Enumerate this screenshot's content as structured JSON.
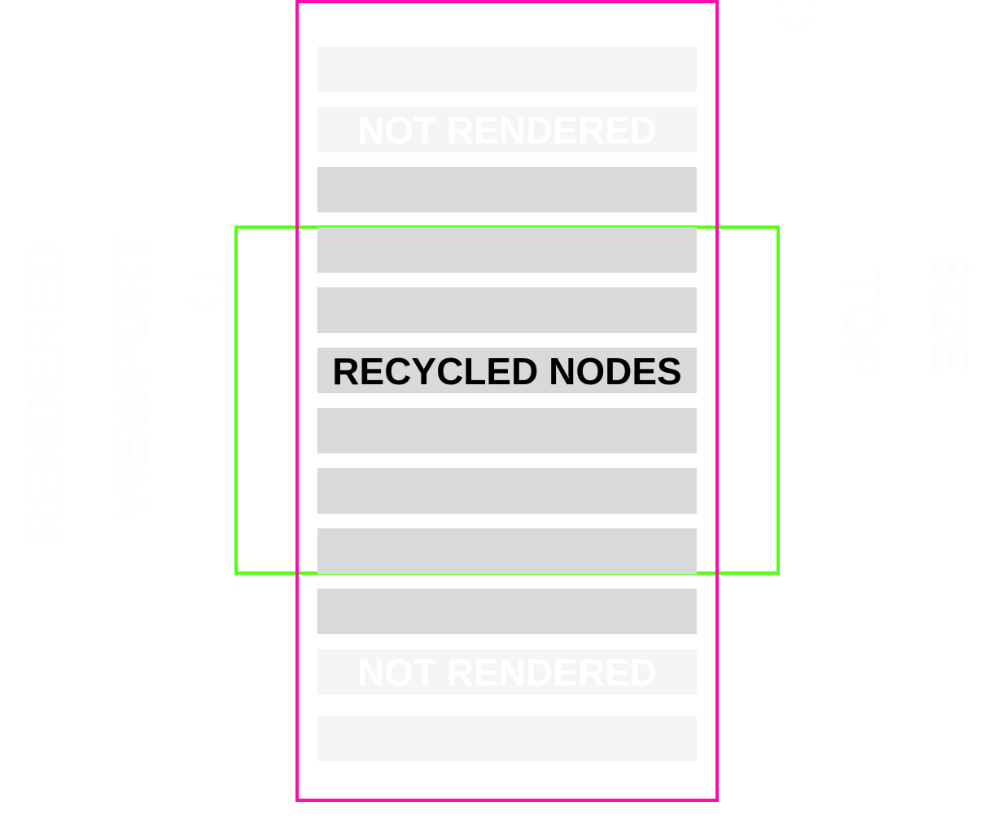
{
  "colors": {
    "list_frame": "#ff0aab",
    "viewport_frame": "#55ff11",
    "rendered_row": "#d9d9d9",
    "not_rendered_row": "#f5f5f5",
    "rendered_label": "#000000",
    "not_rendered_label": "#ffffff"
  },
  "ghost_labels": {
    "left": [
      "RENDERED",
      "VIEWPORT",
      "( )"
    ],
    "right": [
      "TOP",
      "SIZE",
      "( )"
    ]
  },
  "list": {
    "rows": [
      {
        "state": "not-rendered",
        "label": ""
      },
      {
        "state": "not-rendered",
        "label": "NOT RENDERED"
      },
      {
        "state": "rendered",
        "label": ""
      },
      {
        "state": "rendered",
        "label": ""
      },
      {
        "state": "rendered",
        "label": ""
      },
      {
        "state": "rendered",
        "label": "RECYCLED NODES"
      },
      {
        "state": "rendered",
        "label": ""
      },
      {
        "state": "rendered",
        "label": ""
      },
      {
        "state": "rendered",
        "label": ""
      },
      {
        "state": "rendered",
        "label": ""
      },
      {
        "state": "not-rendered",
        "label": "NOT RENDERED"
      },
      {
        "state": "not-rendered",
        "label": ""
      }
    ]
  }
}
